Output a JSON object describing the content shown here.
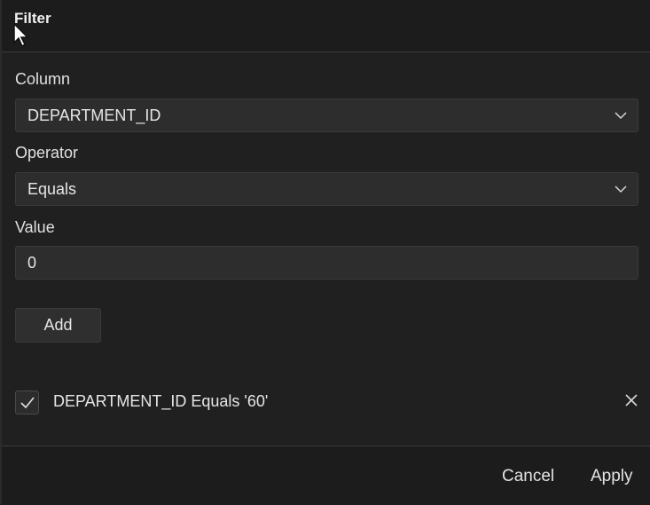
{
  "dialog": {
    "title": "Filter"
  },
  "fields": {
    "column": {
      "label": "Column",
      "value": "DEPARTMENT_ID"
    },
    "operator": {
      "label": "Operator",
      "value": "Equals"
    },
    "value": {
      "label": "Value",
      "value": "0"
    }
  },
  "actions": {
    "add_label": "Add",
    "cancel_label": "Cancel",
    "apply_label": "Apply"
  },
  "filters": [
    {
      "text": "DEPARTMENT_ID Equals '60'",
      "checked": true
    }
  ],
  "icons": {
    "dropdown": "chevron-down-icon",
    "checkbox": "check-icon",
    "remove": "close-icon",
    "pointer": "cursor-icon"
  },
  "colors": {
    "background": "#202020",
    "header_footer": "#1c1c1c",
    "control": "#2d2d2d",
    "border": "#3a3a3a",
    "text": "#e6e6e6"
  }
}
